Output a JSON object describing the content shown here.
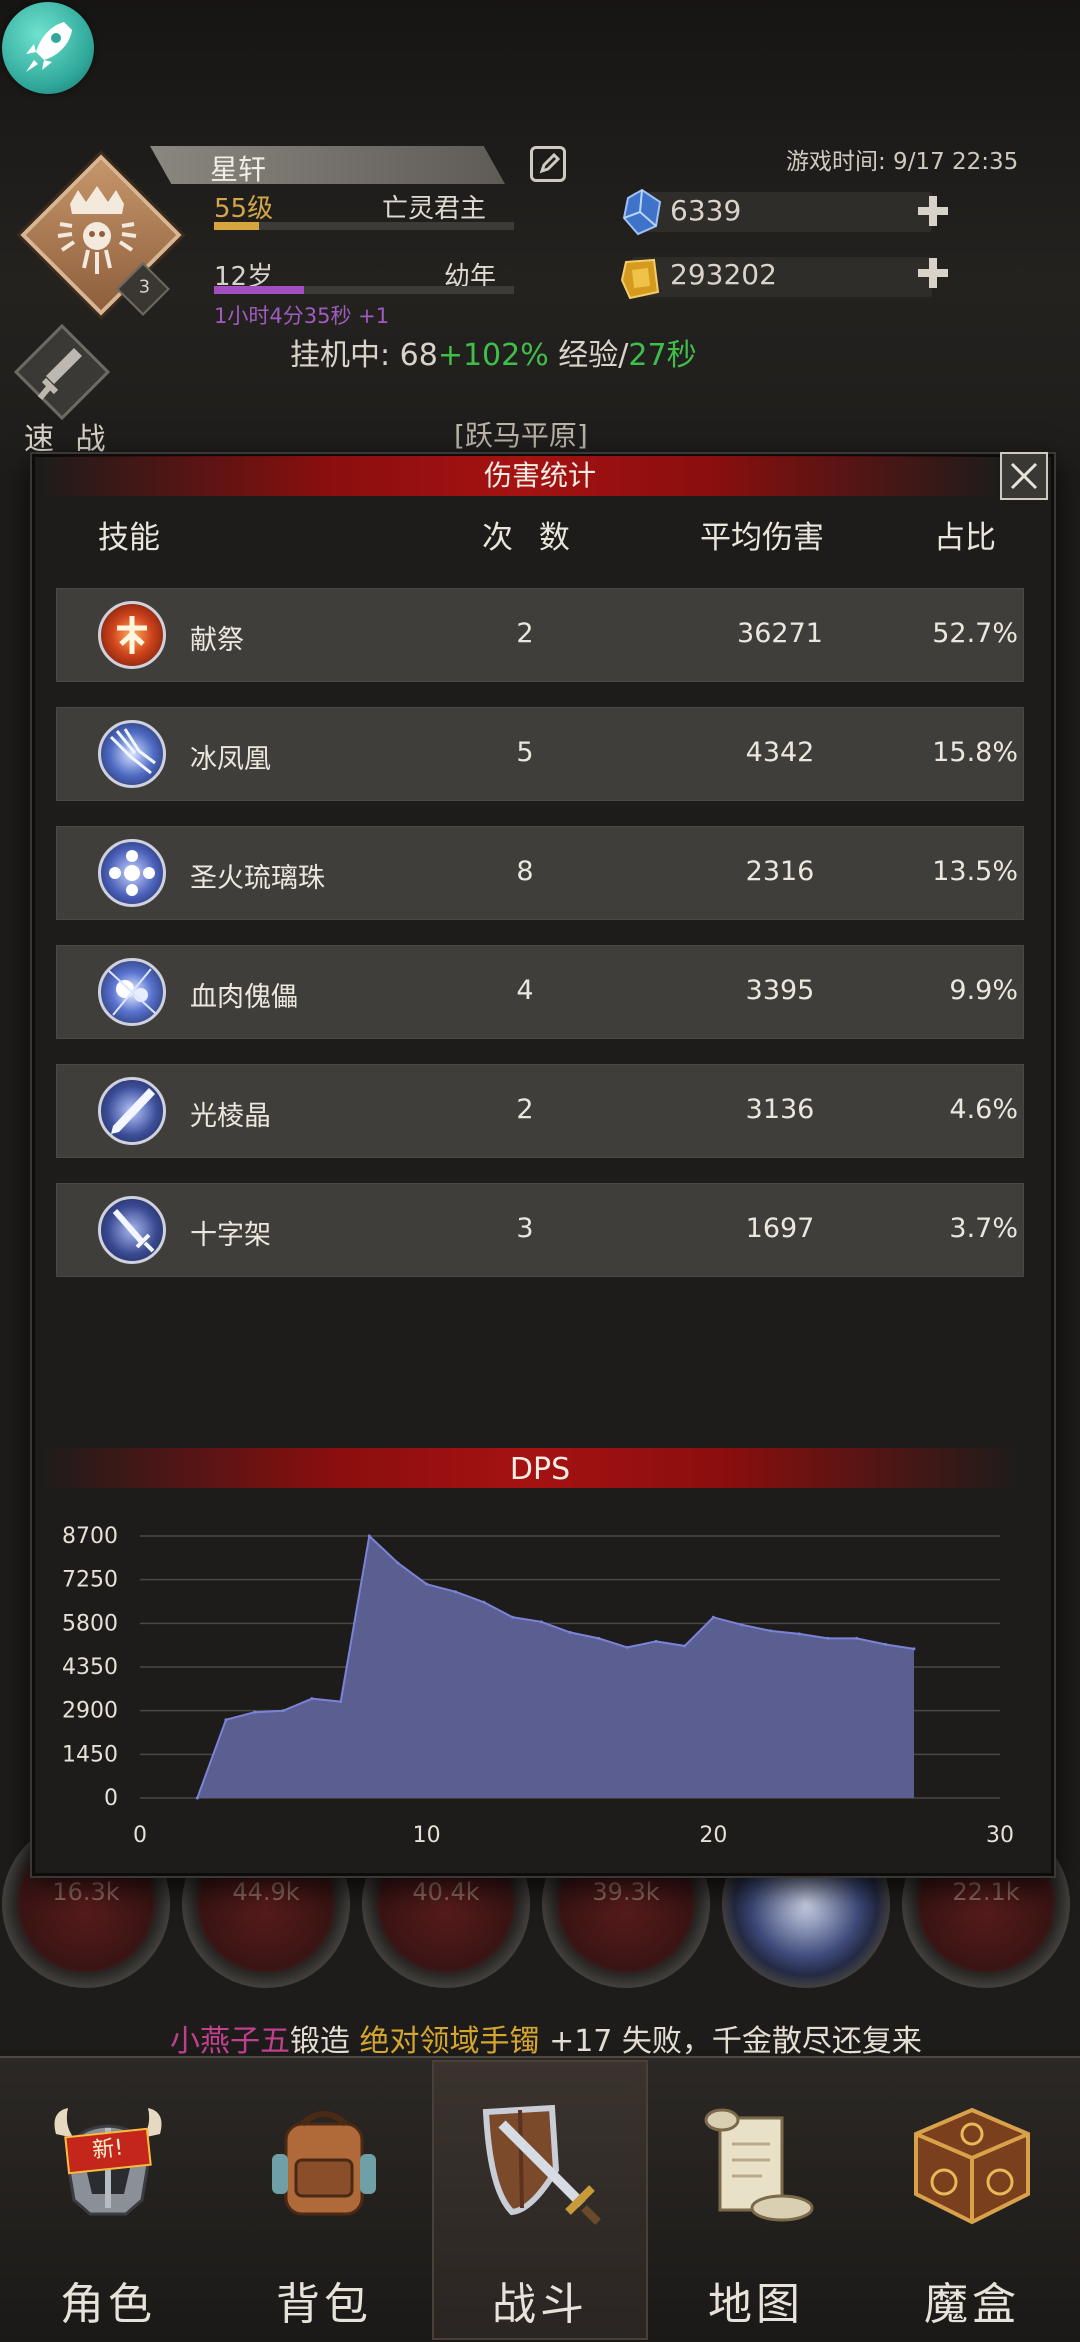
{
  "header": {
    "faint_title": "",
    "player_name": "星轩",
    "level_text": "55级",
    "title_text": "亡灵君主",
    "level_progress": 0.15,
    "age_text": "12岁",
    "stage_text": "幼年",
    "age_progress": 0.3,
    "age_timer": "1小时4分35秒 +1",
    "crest_level": "3",
    "game_time": "游戏时间: 9/17 22:35",
    "gem_value": "6339",
    "gold_value": "293202",
    "idle_prefix": "挂机中: 68",
    "idle_bonus": "+102%",
    "idle_mid": " 经验/",
    "idle_time": "27秒",
    "quick_battle_label": "速 战",
    "location": "[跃马平原]"
  },
  "modal": {
    "title": "伤害统计",
    "columns": {
      "skill": "技能",
      "count": "次 数",
      "avg": "平均伤害",
      "ratio": "占比"
    },
    "skills": [
      {
        "name": "献祭",
        "count": "2",
        "avg": "36271",
        "ratio": "52.7%",
        "icon": "sacrifice-icon"
      },
      {
        "name": "冰凤凰",
        "count": "5",
        "avg": "4342",
        "ratio": "15.8%",
        "icon": "ice-phoenix-icon"
      },
      {
        "name": "圣火琉璃珠",
        "count": "8",
        "avg": "2316",
        "ratio": "13.5%",
        "icon": "holy-fire-orb-icon"
      },
      {
        "name": "血肉傀儡",
        "count": "4",
        "avg": "3395",
        "ratio": "9.9%",
        "icon": "flesh-golem-icon"
      },
      {
        "name": "光棱晶",
        "count": "2",
        "avg": "3136",
        "ratio": "4.6%",
        "icon": "prism-crystal-icon"
      },
      {
        "name": "十字架",
        "count": "3",
        "avg": "1697",
        "ratio": "3.7%",
        "icon": "cross-sword-icon"
      }
    ],
    "dps_title": "DPS"
  },
  "chart_data": {
    "type": "area",
    "title": "DPS",
    "x": [
      2,
      3,
      4,
      5,
      6,
      7,
      8,
      9,
      10,
      11,
      12,
      13,
      14,
      15,
      16,
      17,
      18,
      19,
      20,
      21,
      22,
      23,
      24,
      25,
      26,
      27
    ],
    "y": [
      0,
      2600,
      2850,
      2900,
      3300,
      3200,
      8700,
      7800,
      7100,
      6850,
      6500,
      6000,
      5850,
      5500,
      5300,
      5000,
      5200,
      5050,
      6000,
      5750,
      5550,
      5450,
      5300,
      5300,
      5100,
      4950
    ],
    "xlim": [
      0,
      30
    ],
    "ylim": [
      0,
      8700
    ],
    "xticks": [
      0,
      10,
      20,
      30
    ],
    "yticks": [
      0,
      1450,
      2900,
      4350,
      5800,
      7250,
      8700
    ],
    "grid": true,
    "fill_color": "#5b5e90",
    "line_color": "#7a83d6"
  },
  "background": {
    "orb_values": [
      "16.3k",
      "44.9k",
      "40.4k",
      "39.3k",
      "",
      "22.1k"
    ]
  },
  "ticker": {
    "name": "小燕子五",
    "action": "锻造 ",
    "item": "绝对领域手镯",
    "rest": " +17 失败，千金散尽还复来"
  },
  "nav": {
    "items": [
      {
        "label": "角色",
        "icon": "helmet-icon",
        "badge": "新!"
      },
      {
        "label": "背包",
        "icon": "backpack-icon"
      },
      {
        "label": "战斗",
        "icon": "sword-shield-icon",
        "active": true
      },
      {
        "label": "地图",
        "icon": "scroll-map-icon"
      },
      {
        "label": "魔盒",
        "icon": "magic-box-icon"
      }
    ]
  },
  "colors": {
    "accent_red": "#a51212",
    "exp_green": "#3fbf4a",
    "level_gold": "#d5a640",
    "age_purple": "#a24fbf"
  }
}
